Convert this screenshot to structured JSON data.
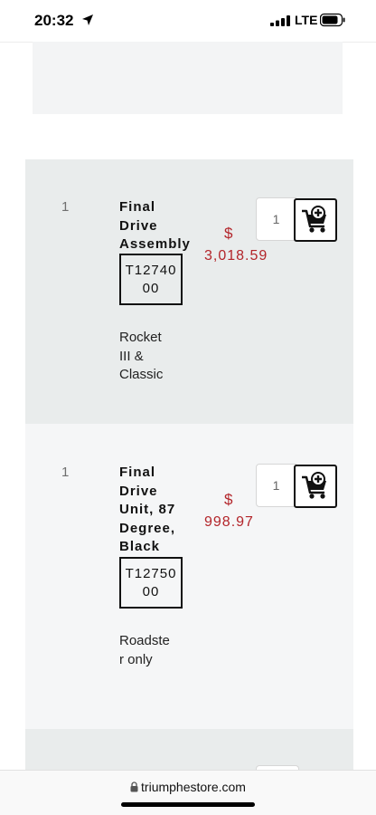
{
  "status_bar": {
    "time": "20:32",
    "network": "LTE"
  },
  "products": [
    {
      "qty": "1",
      "name": "Final Drive Assembly",
      "part_number": "T1274000",
      "fitment": "Rocket III & Classic",
      "price_symbol": "$",
      "price": "3,018.59",
      "qty_value": "1"
    },
    {
      "qty": "1",
      "name": "Final Drive Unit, 87 Degree, Black",
      "part_number": "T1275000",
      "fitment": "Roadster only",
      "price_symbol": "$",
      "price": "998.97",
      "qty_value": "1"
    }
  ],
  "browser": {
    "url": "triumphestore.com"
  },
  "colors": {
    "price": "#b3252a",
    "row_dark": "#e9ecec",
    "row_light": "#f5f6f7"
  }
}
